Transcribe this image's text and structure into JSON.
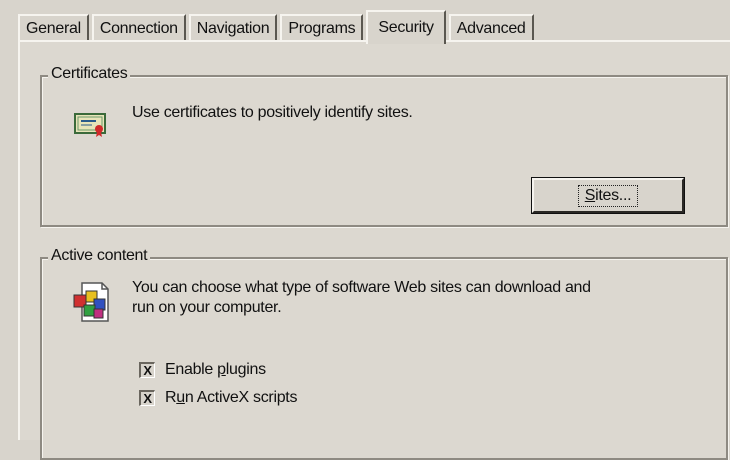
{
  "tabs": [
    {
      "label": "General"
    },
    {
      "label": "Connection"
    },
    {
      "label": "Navigation"
    },
    {
      "label": "Programs"
    },
    {
      "label": "Security",
      "active": true
    },
    {
      "label": "Advanced"
    }
  ],
  "certificates": {
    "legend": "Certificates",
    "description": "Use certificates to positively identify sites.",
    "icon": "certificate-icon",
    "sites_button": {
      "before": "",
      "mnemonic": "S",
      "after": "ites..."
    }
  },
  "active_content": {
    "legend": "Active content",
    "description_line1": "You can choose what type of software Web sites can download and",
    "description_line2": "run on your computer.",
    "icon": "software-components-icon",
    "options": [
      {
        "before": "Enable ",
        "mnemonic": "p",
        "after": "lugins",
        "checked": true,
        "mark": "X"
      },
      {
        "before": "R",
        "mnemonic": "u",
        "after": "n ActiveX scripts",
        "checked": true,
        "mark": "X"
      }
    ]
  }
}
